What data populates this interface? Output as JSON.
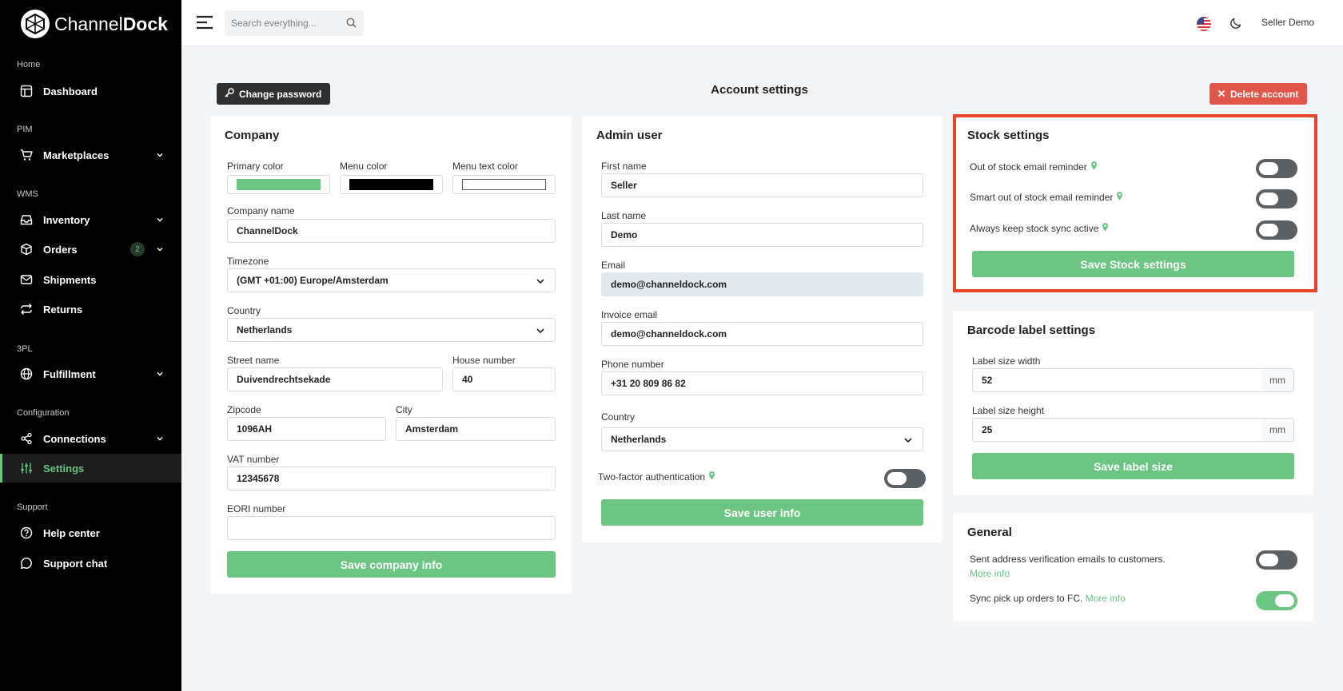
{
  "brand": {
    "name_light": "Channel",
    "name_bold": "Dock"
  },
  "sidebar": {
    "sections": {
      "home": "Home",
      "pim": "PIM",
      "wms": "WMS",
      "tpl": "3PL",
      "configuration": "Configuration",
      "support": "Support"
    },
    "items": {
      "dashboard": "Dashboard",
      "marketplaces": "Marketplaces",
      "inventory": "Inventory",
      "orders": "Orders",
      "orders_badge": "2",
      "shipments": "Shipments",
      "returns": "Returns",
      "fulfillment": "Fulfillment",
      "connections": "Connections",
      "settings": "Settings",
      "help_center": "Help center",
      "support_chat": "Support chat"
    }
  },
  "topbar": {
    "search_placeholder": "Search everything...",
    "user_name": "Seller Demo"
  },
  "header": {
    "change_password": "Change password",
    "title": "Account settings",
    "delete_account": "Delete account"
  },
  "company": {
    "title": "Company",
    "primary_color_label": "Primary color",
    "menu_color_label": "Menu color",
    "menu_text_color_label": "Menu text color",
    "primary_color": "#6cc582",
    "menu_color": "#000000",
    "menu_text_color": "#ffffff",
    "company_name_label": "Company name",
    "company_name": "ChannelDock",
    "timezone_label": "Timezone",
    "timezone": "(GMT +01:00) Europe/Amsterdam",
    "country_label": "Country",
    "country": "Netherlands",
    "street_label": "Street name",
    "street": "Duivendrechtsekade",
    "house_label": "House number",
    "house": "40",
    "zip_label": "Zipcode",
    "zip": "1096AH",
    "city_label": "City",
    "city": "Amsterdam",
    "vat_label": "VAT number",
    "vat": "12345678",
    "eori_label": "EORI number",
    "eori": "",
    "save": "Save company info"
  },
  "admin": {
    "title": "Admin user",
    "first_name_label": "First name",
    "first_name": "Seller",
    "last_name_label": "Last name",
    "last_name": "Demo",
    "email_label": "Email",
    "email": "demo@channeldock.com",
    "invoice_email_label": "Invoice email",
    "invoice_email": "demo@channeldock.com",
    "phone_label": "Phone number",
    "phone": "+31 20 809 86 82",
    "country_label": "Country",
    "country": "Netherlands",
    "twofa_label": "Two-factor authentication",
    "twofa_on": false,
    "save": "Save user info"
  },
  "stock": {
    "title": "Stock settings",
    "out_of_stock": "Out of stock email reminder",
    "smart_out_of_stock": "Smart out of stock email reminder",
    "always_sync": "Always keep stock sync active",
    "save": "Save Stock settings"
  },
  "barcode": {
    "title": "Barcode label settings",
    "width_label": "Label size width",
    "width": "52",
    "height_label": "Label size height",
    "height": "25",
    "unit": "mm",
    "save": "Save label size"
  },
  "general": {
    "title": "General",
    "address_verification": "Sent address verification emails to customers.",
    "more_info": "More info",
    "sync_pickup": "Sync pick up orders to FC.",
    "sync_pickup_on": true
  }
}
